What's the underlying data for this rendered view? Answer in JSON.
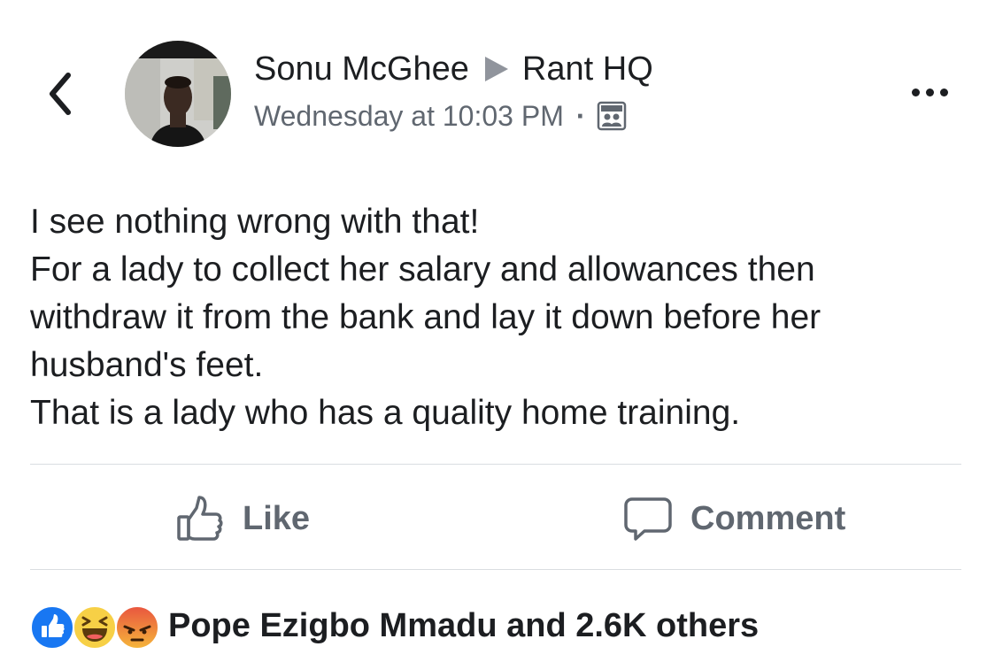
{
  "header": {
    "author_name": "Sonu McGhee",
    "group_name": "Rant HQ",
    "timestamp": "Wednesday at 10:03 PM",
    "separator": "·",
    "audience_icon": "group-audience-icon",
    "back_icon": "chevron-left-icon",
    "more_icon": "more-dots-icon"
  },
  "post": {
    "lines": [
      "I see nothing wrong with that!",
      "For a lady to collect her salary and allowances then",
      "withdraw it from the bank and lay it down before her",
      "husband's feet.",
      "That is a lady who has a quality home training."
    ]
  },
  "actions": {
    "like_label": "Like",
    "comment_label": "Comment",
    "like_icon": "thumbs-up-icon",
    "comment_icon": "speech-bubble-icon"
  },
  "reactions": {
    "types": [
      "like",
      "haha",
      "angry"
    ],
    "summary": "Pope Ezigbo Mmadu and 2.6K others"
  },
  "colors": {
    "text": "#1c1e21",
    "secondary": "#606770",
    "divider": "#dadde1",
    "like_blue": "#1877f2",
    "haha_yellow": "#f7d046",
    "angry_red": "#e9573f"
  }
}
